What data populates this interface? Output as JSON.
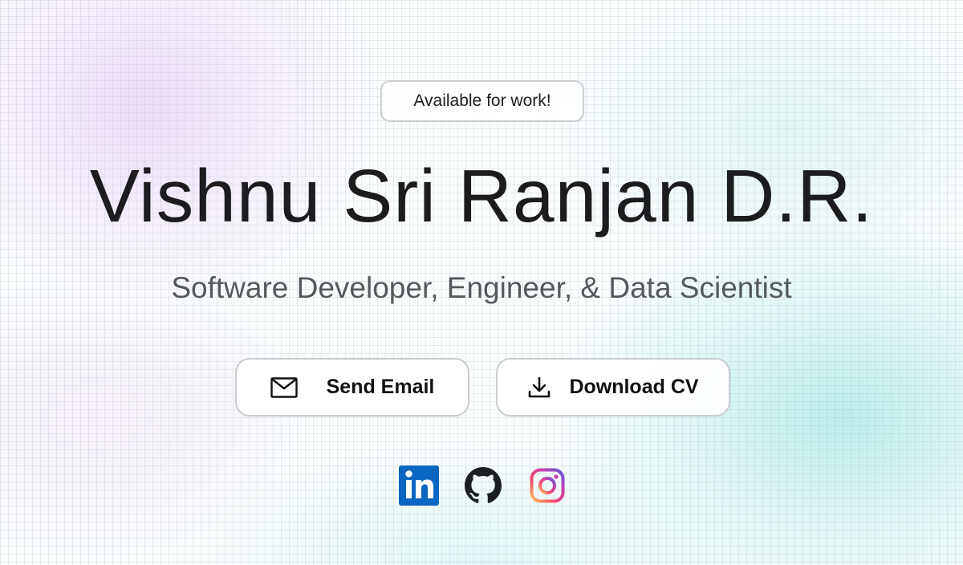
{
  "hero": {
    "availability_badge": "Available for work!",
    "name": "Vishnu Sri Ranjan D.R.",
    "tagline": "Software Developer, Engineer, & Data Scientist"
  },
  "actions": {
    "send_email": {
      "label": "Send Email",
      "icon": "mail-icon"
    },
    "download_cv": {
      "label": "Download CV",
      "icon": "download-icon"
    }
  },
  "social_links": [
    {
      "name": "LinkedIn",
      "icon": "linkedin-icon",
      "color": "#0a66c2"
    },
    {
      "name": "GitHub",
      "icon": "github-icon",
      "color": "#1b1f23"
    },
    {
      "name": "Instagram",
      "icon": "instagram-icon",
      "color": "#e1306c"
    }
  ],
  "colors": {
    "text_primary": "#1c1c1e",
    "text_secondary": "#55595c",
    "border": "#c9cdcf",
    "gradient_pink": "#e9d2f5",
    "gradient_teal": "#b2ece8"
  }
}
